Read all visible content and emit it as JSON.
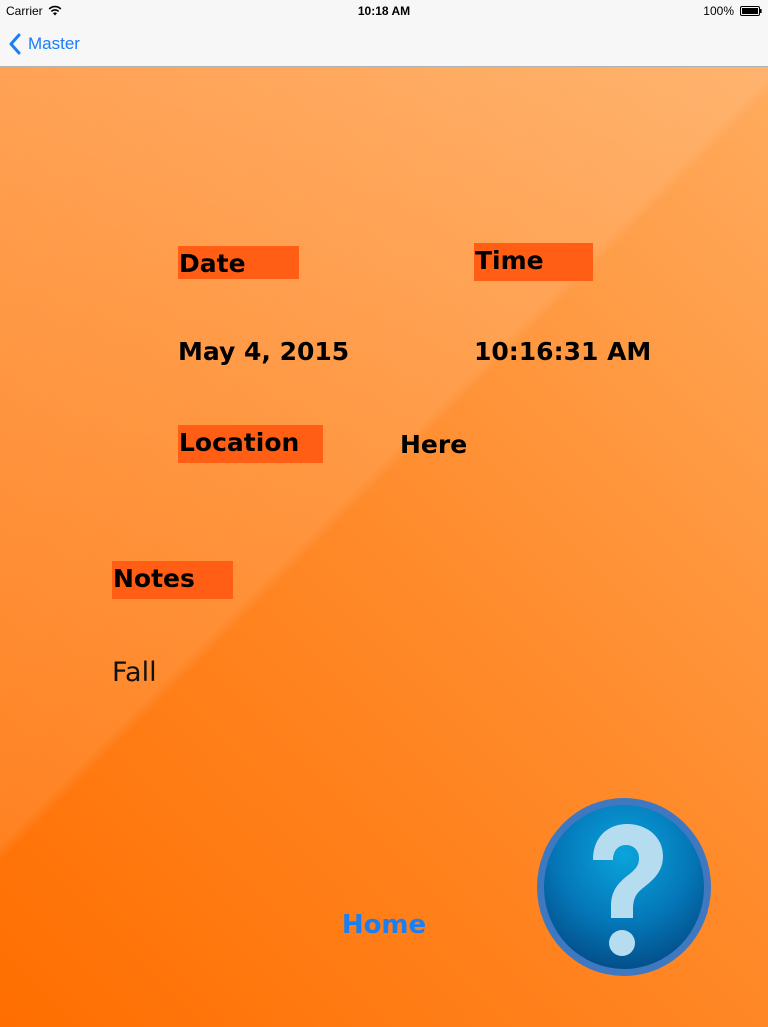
{
  "status_bar": {
    "carrier": "Carrier",
    "time": "10:18 AM",
    "battery": "100%"
  },
  "nav": {
    "back_label": "Master"
  },
  "detail": {
    "date_label": "Date",
    "date_value": "May 4, 2015",
    "time_label": "Time",
    "time_value": "10:16:31 AM",
    "location_label": "Location",
    "location_value": "Here",
    "notes_label": "Notes",
    "notes_value": "Fall"
  },
  "actions": {
    "home_label": "Home",
    "help_icon": "question-mark-icon"
  },
  "colors": {
    "accent": "#1a7ef5",
    "background_orange": "#ff6e00",
    "label_highlight": "#ff5e14",
    "help_blue": "#0a6fb0"
  }
}
